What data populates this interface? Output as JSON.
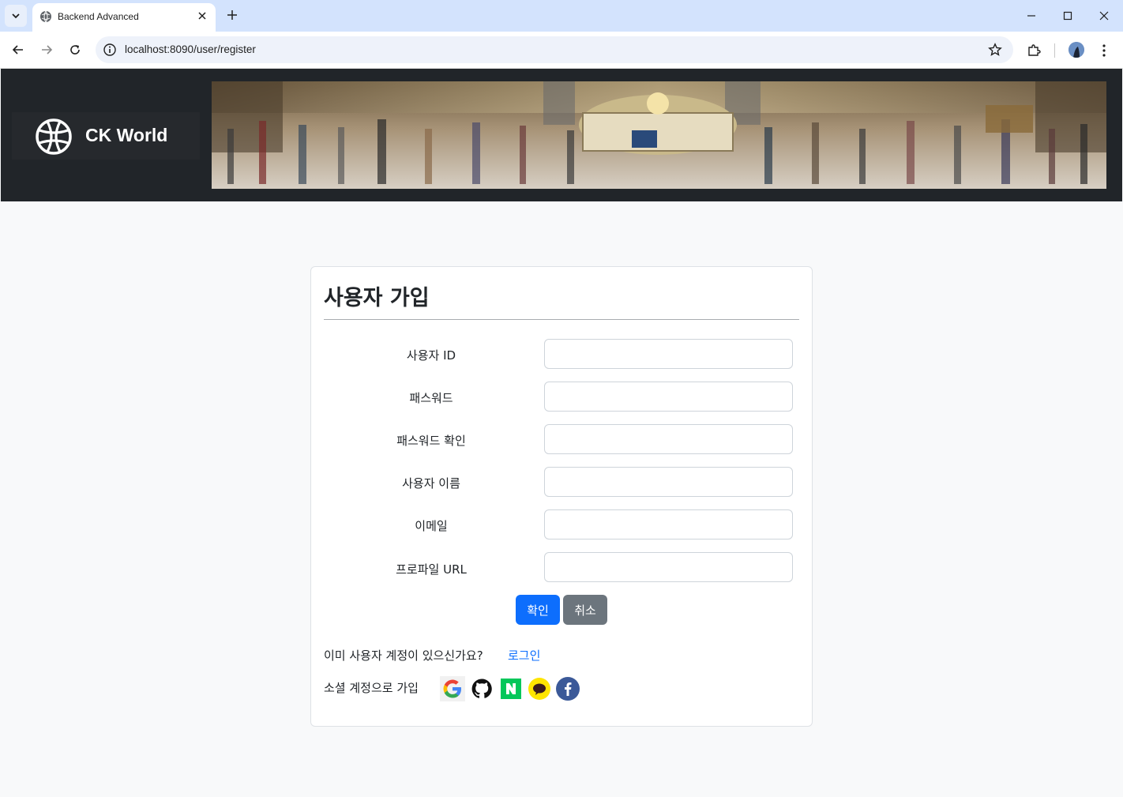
{
  "browser": {
    "tab_title": "Backend Advanced",
    "url": "localhost:8090/user/register"
  },
  "brand": {
    "name": "CK World"
  },
  "form": {
    "title": "사용자 가입",
    "fields": [
      {
        "label": "사용자 ID",
        "value": ""
      },
      {
        "label": "패스워드",
        "value": ""
      },
      {
        "label": "패스워드 확인",
        "value": ""
      },
      {
        "label": "사용자 이름",
        "value": ""
      },
      {
        "label": "이메일",
        "value": ""
      },
      {
        "label": "프로파일 URL",
        "value": ""
      }
    ],
    "confirm_label": "확인",
    "cancel_label": "취소",
    "already_text": "이미 사용자 계정이 있으신가요?",
    "login_link": "로그인",
    "social_label": "소셜 계정으로 가입",
    "social_icons": [
      "google-icon",
      "github-icon",
      "naver-icon",
      "kakao-icon",
      "facebook-icon"
    ]
  },
  "colors": {
    "primary": "#0d6efd",
    "secondary": "#6c757d",
    "header_bg": "#212529",
    "tabstrip_bg": "#d3e3fd"
  }
}
